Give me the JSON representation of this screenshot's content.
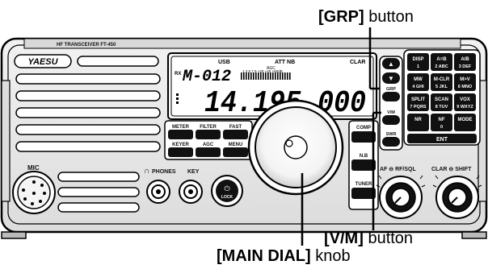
{
  "callouts": {
    "grp_bold": "[GRP]",
    "grp_rest": " button",
    "vm_bold": "[V/M]",
    "vm_rest": " button",
    "dial_bold": "[MAIN DIAL]",
    "dial_rest": " knob"
  },
  "radio": {
    "brand": "YAESU",
    "model_strip": "HF TRANSCEIVER FT-450",
    "display": {
      "mode": "USB",
      "att_nb": "ATT NB",
      "clar": "CLAR",
      "agc_label": "AGC",
      "rx": "RX",
      "memory": "M-012",
      "frequency": "14.195.000",
      "scale": "1 3 5 7 9 +20 +40 +60dB"
    },
    "left_buttons": [
      "METER",
      "FILTER",
      "FAST",
      "KEYER",
      "AGC",
      "MENU"
    ],
    "right_side_buttons": [
      "GRP",
      "V/M",
      "SWR"
    ],
    "right_col_buttons": [
      "COMP",
      "N.B",
      "TUNER"
    ],
    "keypad": [
      {
        "top": "DISP",
        "bottom": "1"
      },
      {
        "top": "A=B",
        "bottom": "2 ABC"
      },
      {
        "top": "A/B",
        "bottom": "3 DEF"
      },
      {
        "top": "MW",
        "bottom": "4 GHI"
      },
      {
        "top": "M-CLR",
        "bottom": "5 JKL"
      },
      {
        "top": "M>V",
        "bottom": "6 MNO"
      },
      {
        "top": "SPLIT",
        "bottom": "7 PQRS"
      },
      {
        "top": "SCAN",
        "bottom": "8 TUV"
      },
      {
        "top": "VOX",
        "bottom": "9 WXYZ"
      },
      {
        "top": "NR",
        "bottom": ""
      },
      {
        "top": "NF",
        "bottom": "0"
      },
      {
        "top": "MODE",
        "bottom": ""
      }
    ],
    "ent": "ENT",
    "mic": "MIC",
    "phones": "PHONES",
    "key": "KEY",
    "lock": "LOCK",
    "af_rfsql": "AF ⊖ RF/SQL",
    "clar_shift": "CLAR ⊖ SHIFT"
  },
  "colors": {
    "panel": "#e9e9e9",
    "key_fill": "#1a1a1a",
    "outline": "#000000"
  }
}
